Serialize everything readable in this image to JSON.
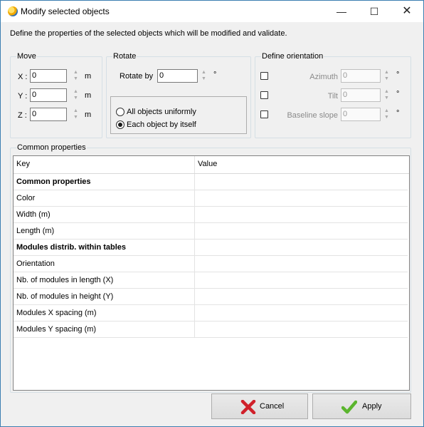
{
  "window": {
    "title": "Modify selected objects",
    "controls": {
      "minimize": "—",
      "maximize": "☐",
      "close": "✕"
    }
  },
  "description": "Define the properties of the selected objects which will be modified and validate.",
  "move": {
    "legend": "Move",
    "unit": "m",
    "fields": [
      {
        "label": "X :",
        "value": "0"
      },
      {
        "label": "Y :",
        "value": "0"
      },
      {
        "label": "Z :",
        "value": "0"
      }
    ]
  },
  "rotate": {
    "legend": "Rotate",
    "label": "Rotate by",
    "value": "0",
    "unit": "°",
    "options": [
      {
        "label": "All objects uniformly",
        "selected": false
      },
      {
        "label": "Each object by itself",
        "selected": true
      }
    ]
  },
  "orientation": {
    "legend": "Define orientation",
    "unit": "°",
    "fields": [
      {
        "label": "Azimuth",
        "value": "0",
        "checked": false
      },
      {
        "label": "Tilt",
        "value": "0",
        "checked": false
      },
      {
        "label": "Baseline slope",
        "value": "0",
        "checked": false
      }
    ]
  },
  "common": {
    "legend": "Common properties",
    "columns": {
      "key": "Key",
      "value": "Value"
    },
    "rows": [
      {
        "key": "Common properties",
        "value": "",
        "section": true
      },
      {
        "key": "Color",
        "value": "",
        "section": false
      },
      {
        "key": "Width (m)",
        "value": "",
        "section": false
      },
      {
        "key": "Length (m)",
        "value": "",
        "section": false
      },
      {
        "key": "Modules distrib. within tables",
        "value": "",
        "section": true
      },
      {
        "key": "Orientation",
        "value": "",
        "section": false
      },
      {
        "key": "Nb. of modules in length (X)",
        "value": "",
        "section": false
      },
      {
        "key": "Nb. of modules in height (Y)",
        "value": "",
        "section": false
      },
      {
        "key": "Modules X spacing (m)",
        "value": "",
        "section": false
      },
      {
        "key": "Modules Y spacing (m)",
        "value": "",
        "section": false
      }
    ]
  },
  "buttons": {
    "cancel": {
      "label": "Cancel",
      "icon": "red-x-icon",
      "color": "#d0202a"
    },
    "apply": {
      "label": "Apply",
      "icon": "green-check-icon",
      "color": "#5bb52e"
    }
  }
}
